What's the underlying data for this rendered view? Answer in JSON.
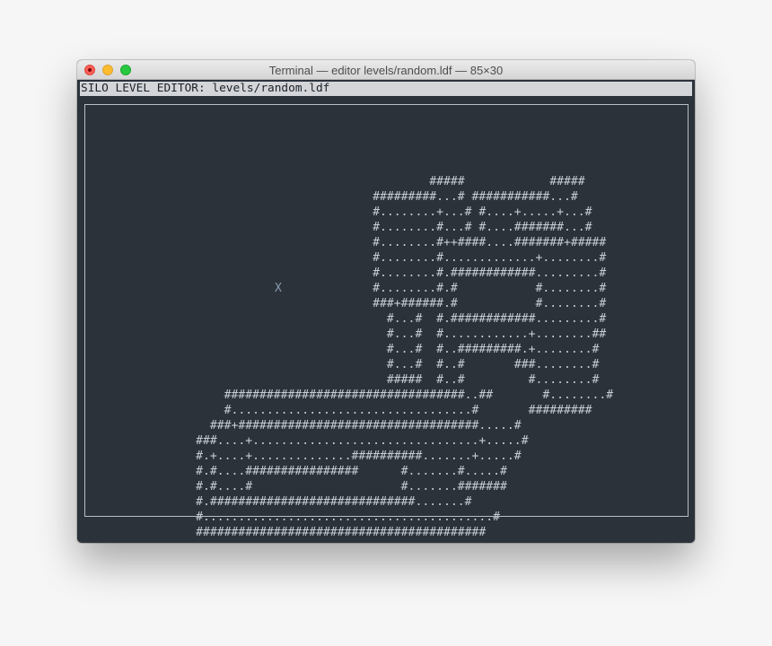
{
  "window": {
    "title": "Terminal — editor levels/random.ldf — 85×30"
  },
  "editor": {
    "status_line": "SILO LEVEL EDITOR: levels/random.ldf",
    "cursor_glyph": "X",
    "map_lines": [
      "                                         #####            #####",
      "                                 #########...# ###########...#",
      "                                 #........+...# #....+.....+...#",
      "                                 #........#...# #....#######...#",
      "                                 #........#++####....#######+#####",
      "                                 #........#.............+........#",
      "                                 #........#.############.........#",
      "                                 #........#.#           #........#",
      "                                 ###+######.#           #........#",
      "                                   #...#  #.############.........#",
      "                                   #...#  #............+........##",
      "                                   #...#  #..#########.+........#",
      "                                   #...#  #..#       ###........#",
      "                                   #####  #..#         #........#",
      "            ##################################..##       #........#",
      "            #..................................#       #########",
      "          ###+##################################.....#",
      "        ###....+................................+.....#",
      "        #.+....+..............##########.......+.....#",
      "        #.#....################      #.......#.....#",
      "        #.#....#                     #.......#######",
      "        #.#############################.......#",
      "        #.........................................#",
      "        #########################################"
    ]
  },
  "colors": {
    "terminal_background": "#2b323a",
    "text": "#c6ccd3",
    "status_bar": "#d3d5d9",
    "cursor": "#8a9bb0"
  }
}
